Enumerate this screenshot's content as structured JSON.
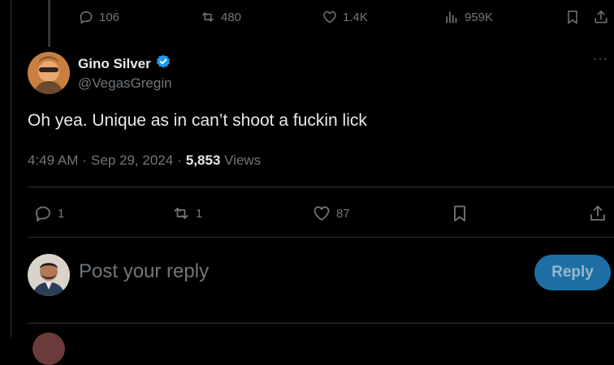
{
  "prev_tweet": {
    "replies": "106",
    "reposts": "480",
    "likes": "1.4K",
    "views": "959K"
  },
  "tweet": {
    "display_name": "Gino Silver",
    "handle": "@VegasGregin",
    "text": "Oh yea. Unique as in can’t shoot a fuckin lick",
    "time": "4:49 AM",
    "date": "Sep 29, 2024",
    "views_count": "5,853",
    "views_label": "Views",
    "replies": "1",
    "reposts": "1",
    "likes": "87",
    "more_label": "···"
  },
  "reply_box": {
    "placeholder": "Post your reply",
    "button_label": "Reply"
  },
  "colors": {
    "verified": "#1d9bf0",
    "muted": "#71767b",
    "reply_button": "#1d6fa5"
  }
}
